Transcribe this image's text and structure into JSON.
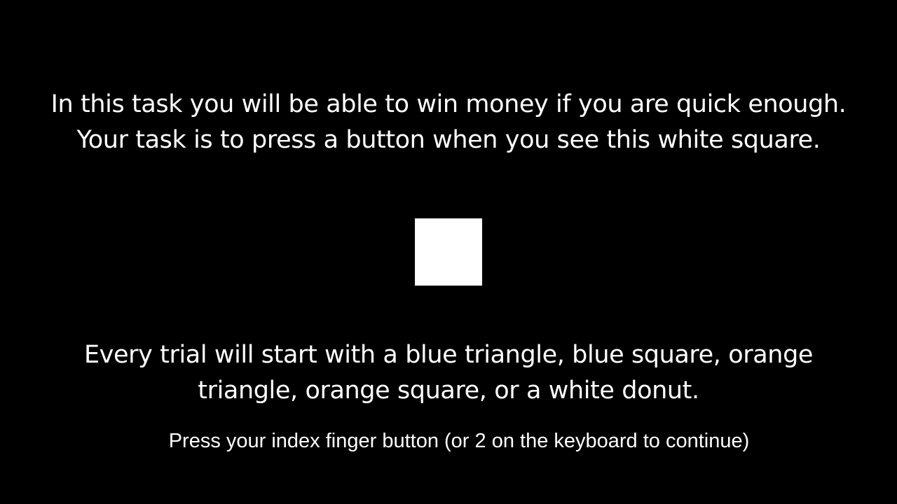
{
  "instructions": {
    "line1": "In this task you will be able to win money if you are quick enough.",
    "line2": "Your task is to press a button when you see this white square.",
    "trials_text": "Every trial will start with a blue triangle, blue square, orange triangle,  orange square, or a white donut.",
    "continue_prompt": "Press your index finger button (or 2 on the keyboard to continue)"
  },
  "colors": {
    "background": "#000000",
    "text": "#ffffff",
    "target_square": "#ffffff"
  }
}
